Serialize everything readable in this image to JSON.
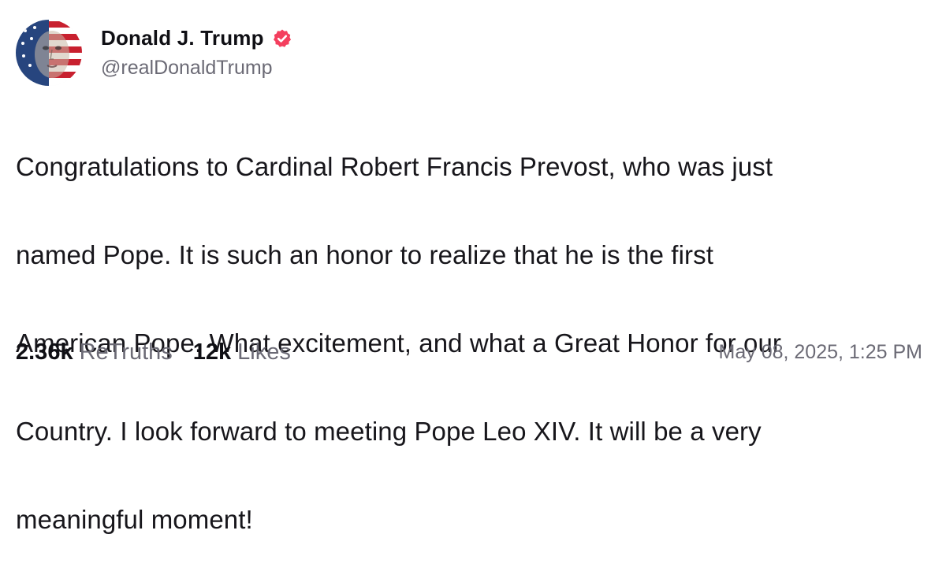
{
  "author": {
    "display_name": "Donald J. Trump",
    "handle": "@realDonaldTrump",
    "verified": true,
    "verified_badge_color": "#f43f5e",
    "avatar_icon": "avatar-portrait-flag"
  },
  "post": {
    "lines": [
      "Congratulations to Cardinal Robert Francis Prevost, who was just",
      "named Pope. It is such an honor to realize that he is the first",
      "American Pope. What excitement, and what a Great Honor for our",
      "Country. I look forward to meeting Pope Leo XIV. It will be a very",
      "meaningful moment!"
    ]
  },
  "stats": {
    "retruths": {
      "count": "2.36k",
      "label": "ReTruths"
    },
    "likes": {
      "count": "12k",
      "label": "Likes"
    }
  },
  "timestamp": "May 08, 2025, 1:25 PM",
  "colors": {
    "text_primary": "#17161b",
    "text_secondary": "#6b6a75",
    "background": "#ffffff"
  }
}
